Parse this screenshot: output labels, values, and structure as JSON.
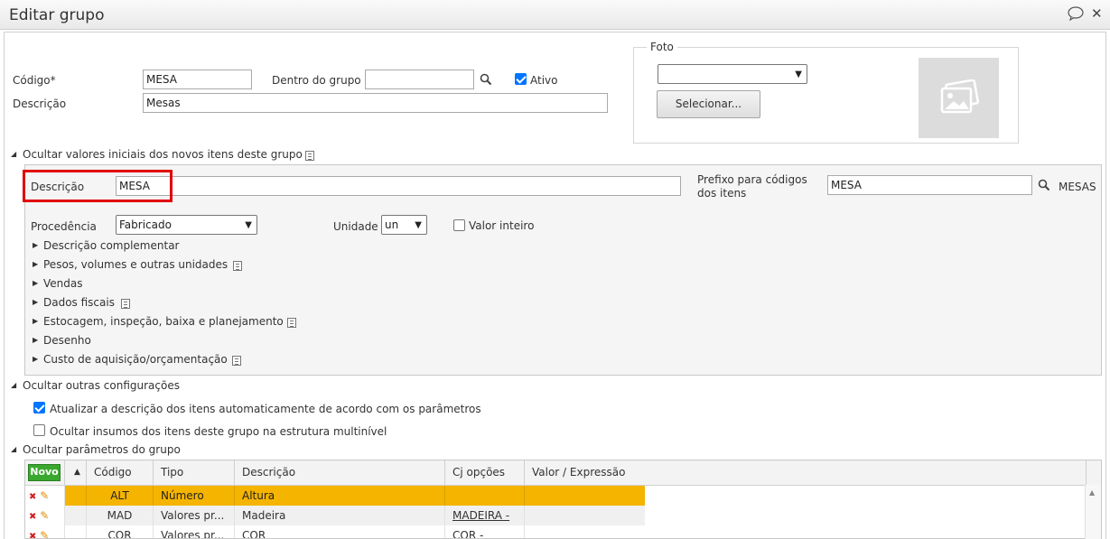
{
  "window": {
    "title": "Editar grupo"
  },
  "main": {
    "codigo_label": "Código*",
    "codigo_value": "MESA",
    "dentro_label": "Dentro do grupo",
    "dentro_value": "",
    "ativo_label": "Ativo",
    "ativo_checked": true,
    "descricao_label": "Descrição",
    "descricao_value": "Mesas"
  },
  "foto": {
    "legend": "Foto",
    "select_value": "",
    "button_label": "Selecionar..."
  },
  "initial_values": {
    "toggle_label": "Ocultar valores iniciais dos novos itens deste grupo",
    "descricao_label": "Descrição",
    "descricao_value": "MESA",
    "prefixo_label_line1": "Prefixo para códigos",
    "prefixo_label_line2": "dos itens",
    "prefixo_value": "MESA",
    "prefixo_result": "MESAS",
    "procedencia_label": "Procedência",
    "procedencia_value": "Fabricado",
    "unidade_label": "Unidade",
    "unidade_value": "un",
    "valor_inteiro_label": "Valor inteiro",
    "valor_inteiro_checked": false,
    "sections": [
      {
        "label": "Descrição complementar",
        "has_note": false
      },
      {
        "label": "Pesos, volumes e outras unidades",
        "has_note": true
      },
      {
        "label": "Vendas",
        "has_note": false
      },
      {
        "label": "Dados fiscais",
        "has_note": true
      },
      {
        "label": "Estocagem, inspeção, baixa e planejamento",
        "has_note": true
      },
      {
        "label": "Desenho",
        "has_note": false
      },
      {
        "label": "Custo de aquisição/orçamentação",
        "has_note": true
      }
    ]
  },
  "other_config": {
    "toggle_label": "Ocultar outras configurações",
    "opt1_label": "Atualizar a descrição dos itens automaticamente de acordo com os parâmetros",
    "opt1_checked": true,
    "opt2_label": "Ocultar insumos dos itens deste grupo na estrutura multinível",
    "opt2_checked": false
  },
  "params": {
    "toggle_label": "Ocultar parâmetros do grupo",
    "novo_label": "Novo",
    "columns": [
      "Código",
      "Tipo",
      "Descrição",
      "Cj opções",
      "Valor / Expressão"
    ],
    "rows": [
      {
        "codigo": "ALT",
        "tipo": "Número",
        "descricao": "Altura",
        "cj": "",
        "valor": "",
        "selected": true
      },
      {
        "codigo": "MAD",
        "tipo": "Valores pr...",
        "descricao": "Madeira",
        "cj": "MADEIRA -",
        "valor": "",
        "selected": false
      },
      {
        "codigo": "COR",
        "tipo": "Valores pr...",
        "descricao": "COR",
        "cj": "COR -",
        "valor": "",
        "selected": false
      }
    ]
  }
}
